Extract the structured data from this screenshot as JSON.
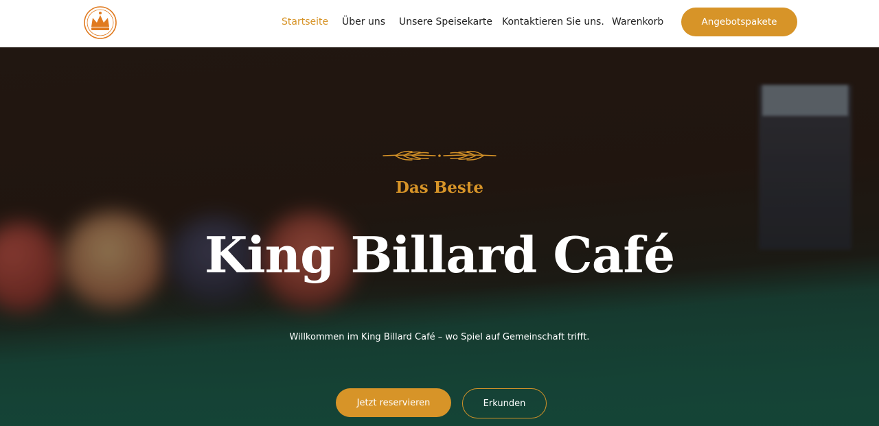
{
  "brand": {
    "logo_icon": "crown-logo-icon",
    "accent": "#d79428"
  },
  "nav": {
    "items": [
      {
        "label": "Startseite",
        "active": true
      },
      {
        "label": "Über uns",
        "active": false
      },
      {
        "label": "Unsere Speisekarte",
        "active": false
      },
      {
        "label": "Kontaktieren Sie uns.",
        "active": false
      },
      {
        "label": "Warenkorb",
        "active": false
      }
    ],
    "cta_label": "Angebotspakete"
  },
  "hero": {
    "ornament_icon": "laurel-divider-icon",
    "kicker": "Das Beste",
    "title": "King Billard Café",
    "subtitle": "Willkommen im King Billard Café – wo Spiel auf Gemeinschaft trifft.",
    "primary_button": "Jetzt reservieren",
    "secondary_button": "Erkunden"
  }
}
